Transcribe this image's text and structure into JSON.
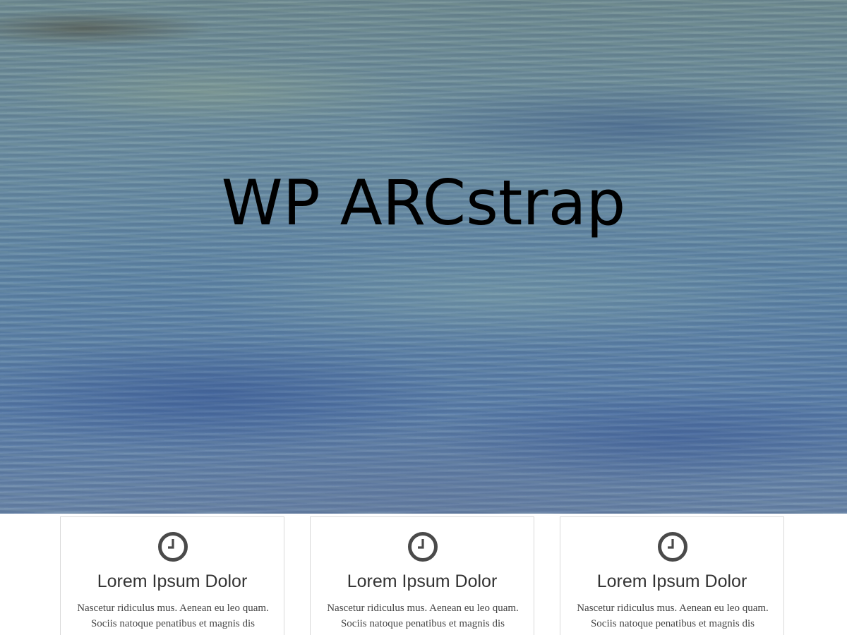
{
  "hero": {
    "title": "WP ARCstrap"
  },
  "features": [
    {
      "icon": "clock-icon",
      "title": "Lorem Ipsum Dolor",
      "text": "Nascetur ridiculus mus. Aenean eu leo quam. Sociis natoque penatibus et magnis dis parturient montes."
    },
    {
      "icon": "clock-icon",
      "title": "Lorem Ipsum Dolor",
      "text": "Nascetur ridiculus mus. Aenean eu leo quam. Sociis natoque penatibus et magnis dis parturient montes."
    },
    {
      "icon": "clock-icon",
      "title": "Lorem Ipsum Dolor",
      "text": "Nascetur ridiculus mus. Aenean eu leo quam. Sociis natoque penatibus et magnis dis parturient montes."
    }
  ],
  "colors": {
    "icon": "#4a4a4a",
    "title": "#333333",
    "body_text": "#444444",
    "card_border": "#d9d9d9"
  }
}
